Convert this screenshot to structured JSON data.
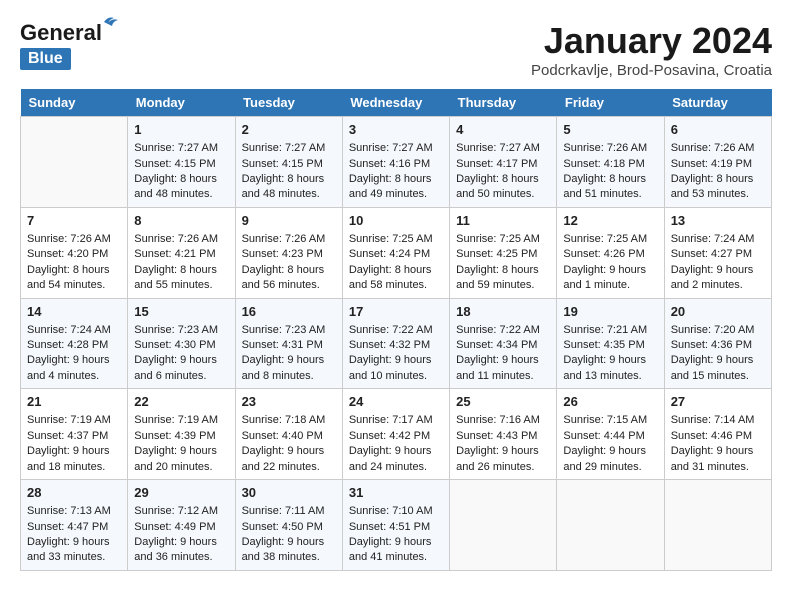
{
  "header": {
    "logo_line1": "General",
    "logo_line2": "Blue",
    "month": "January 2024",
    "location": "Podcrkavlje, Brod-Posavina, Croatia"
  },
  "weekdays": [
    "Sunday",
    "Monday",
    "Tuesday",
    "Wednesday",
    "Thursday",
    "Friday",
    "Saturday"
  ],
  "weeks": [
    [
      {
        "day": "",
        "info": ""
      },
      {
        "day": "1",
        "info": "Sunrise: 7:27 AM\nSunset: 4:15 PM\nDaylight: 8 hours\nand 48 minutes."
      },
      {
        "day": "2",
        "info": "Sunrise: 7:27 AM\nSunset: 4:15 PM\nDaylight: 8 hours\nand 48 minutes."
      },
      {
        "day": "3",
        "info": "Sunrise: 7:27 AM\nSunset: 4:16 PM\nDaylight: 8 hours\nand 49 minutes."
      },
      {
        "day": "4",
        "info": "Sunrise: 7:27 AM\nSunset: 4:17 PM\nDaylight: 8 hours\nand 50 minutes."
      },
      {
        "day": "5",
        "info": "Sunrise: 7:26 AM\nSunset: 4:18 PM\nDaylight: 8 hours\nand 51 minutes."
      },
      {
        "day": "6",
        "info": "Sunrise: 7:26 AM\nSunset: 4:19 PM\nDaylight: 8 hours\nand 53 minutes."
      }
    ],
    [
      {
        "day": "7",
        "info": "Sunrise: 7:26 AM\nSunset: 4:20 PM\nDaylight: 8 hours\nand 54 minutes."
      },
      {
        "day": "8",
        "info": "Sunrise: 7:26 AM\nSunset: 4:21 PM\nDaylight: 8 hours\nand 55 minutes."
      },
      {
        "day": "9",
        "info": "Sunrise: 7:26 AM\nSunset: 4:23 PM\nDaylight: 8 hours\nand 56 minutes."
      },
      {
        "day": "10",
        "info": "Sunrise: 7:25 AM\nSunset: 4:24 PM\nDaylight: 8 hours\nand 58 minutes."
      },
      {
        "day": "11",
        "info": "Sunrise: 7:25 AM\nSunset: 4:25 PM\nDaylight: 8 hours\nand 59 minutes."
      },
      {
        "day": "12",
        "info": "Sunrise: 7:25 AM\nSunset: 4:26 PM\nDaylight: 9 hours\nand 1 minute."
      },
      {
        "day": "13",
        "info": "Sunrise: 7:24 AM\nSunset: 4:27 PM\nDaylight: 9 hours\nand 2 minutes."
      }
    ],
    [
      {
        "day": "14",
        "info": "Sunrise: 7:24 AM\nSunset: 4:28 PM\nDaylight: 9 hours\nand 4 minutes."
      },
      {
        "day": "15",
        "info": "Sunrise: 7:23 AM\nSunset: 4:30 PM\nDaylight: 9 hours\nand 6 minutes."
      },
      {
        "day": "16",
        "info": "Sunrise: 7:23 AM\nSunset: 4:31 PM\nDaylight: 9 hours\nand 8 minutes."
      },
      {
        "day": "17",
        "info": "Sunrise: 7:22 AM\nSunset: 4:32 PM\nDaylight: 9 hours\nand 10 minutes."
      },
      {
        "day": "18",
        "info": "Sunrise: 7:22 AM\nSunset: 4:34 PM\nDaylight: 9 hours\nand 11 minutes."
      },
      {
        "day": "19",
        "info": "Sunrise: 7:21 AM\nSunset: 4:35 PM\nDaylight: 9 hours\nand 13 minutes."
      },
      {
        "day": "20",
        "info": "Sunrise: 7:20 AM\nSunset: 4:36 PM\nDaylight: 9 hours\nand 15 minutes."
      }
    ],
    [
      {
        "day": "21",
        "info": "Sunrise: 7:19 AM\nSunset: 4:37 PM\nDaylight: 9 hours\nand 18 minutes."
      },
      {
        "day": "22",
        "info": "Sunrise: 7:19 AM\nSunset: 4:39 PM\nDaylight: 9 hours\nand 20 minutes."
      },
      {
        "day": "23",
        "info": "Sunrise: 7:18 AM\nSunset: 4:40 PM\nDaylight: 9 hours\nand 22 minutes."
      },
      {
        "day": "24",
        "info": "Sunrise: 7:17 AM\nSunset: 4:42 PM\nDaylight: 9 hours\nand 24 minutes."
      },
      {
        "day": "25",
        "info": "Sunrise: 7:16 AM\nSunset: 4:43 PM\nDaylight: 9 hours\nand 26 minutes."
      },
      {
        "day": "26",
        "info": "Sunrise: 7:15 AM\nSunset: 4:44 PM\nDaylight: 9 hours\nand 29 minutes."
      },
      {
        "day": "27",
        "info": "Sunrise: 7:14 AM\nSunset: 4:46 PM\nDaylight: 9 hours\nand 31 minutes."
      }
    ],
    [
      {
        "day": "28",
        "info": "Sunrise: 7:13 AM\nSunset: 4:47 PM\nDaylight: 9 hours\nand 33 minutes."
      },
      {
        "day": "29",
        "info": "Sunrise: 7:12 AM\nSunset: 4:49 PM\nDaylight: 9 hours\nand 36 minutes."
      },
      {
        "day": "30",
        "info": "Sunrise: 7:11 AM\nSunset: 4:50 PM\nDaylight: 9 hours\nand 38 minutes."
      },
      {
        "day": "31",
        "info": "Sunrise: 7:10 AM\nSunset: 4:51 PM\nDaylight: 9 hours\nand 41 minutes."
      },
      {
        "day": "",
        "info": ""
      },
      {
        "day": "",
        "info": ""
      },
      {
        "day": "",
        "info": ""
      }
    ]
  ]
}
